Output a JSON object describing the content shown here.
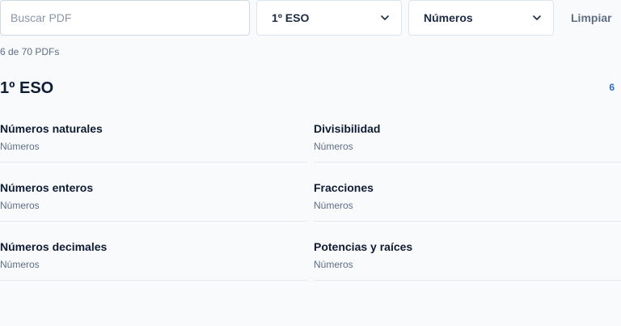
{
  "filters": {
    "search_placeholder": "Buscar PDF",
    "search_value": "",
    "level_selected": "1º ESO",
    "topic_selected": "Números",
    "clear_label": "Limpiar"
  },
  "results": {
    "count_text": "6 de 70 PDFs"
  },
  "section": {
    "title": "1º ESO",
    "count": "6",
    "items": [
      {
        "title": "Números naturales",
        "subtitle": "Números"
      },
      {
        "title": "Divisibilidad",
        "subtitle": "Números"
      },
      {
        "title": "Números enteros",
        "subtitle": "Números"
      },
      {
        "title": "Fracciones",
        "subtitle": "Números"
      },
      {
        "title": "Números decimales",
        "subtitle": "Números"
      },
      {
        "title": "Potencias y raíces",
        "subtitle": "Números"
      }
    ]
  },
  "colors": {
    "background": "#f8fafc",
    "text_primary": "#0f1c33",
    "text_secondary": "#5f6e84",
    "accent": "#2f6fb5",
    "border": "#cfd8e3"
  },
  "icons": {
    "select_arrow": "chevron-down-icon"
  }
}
